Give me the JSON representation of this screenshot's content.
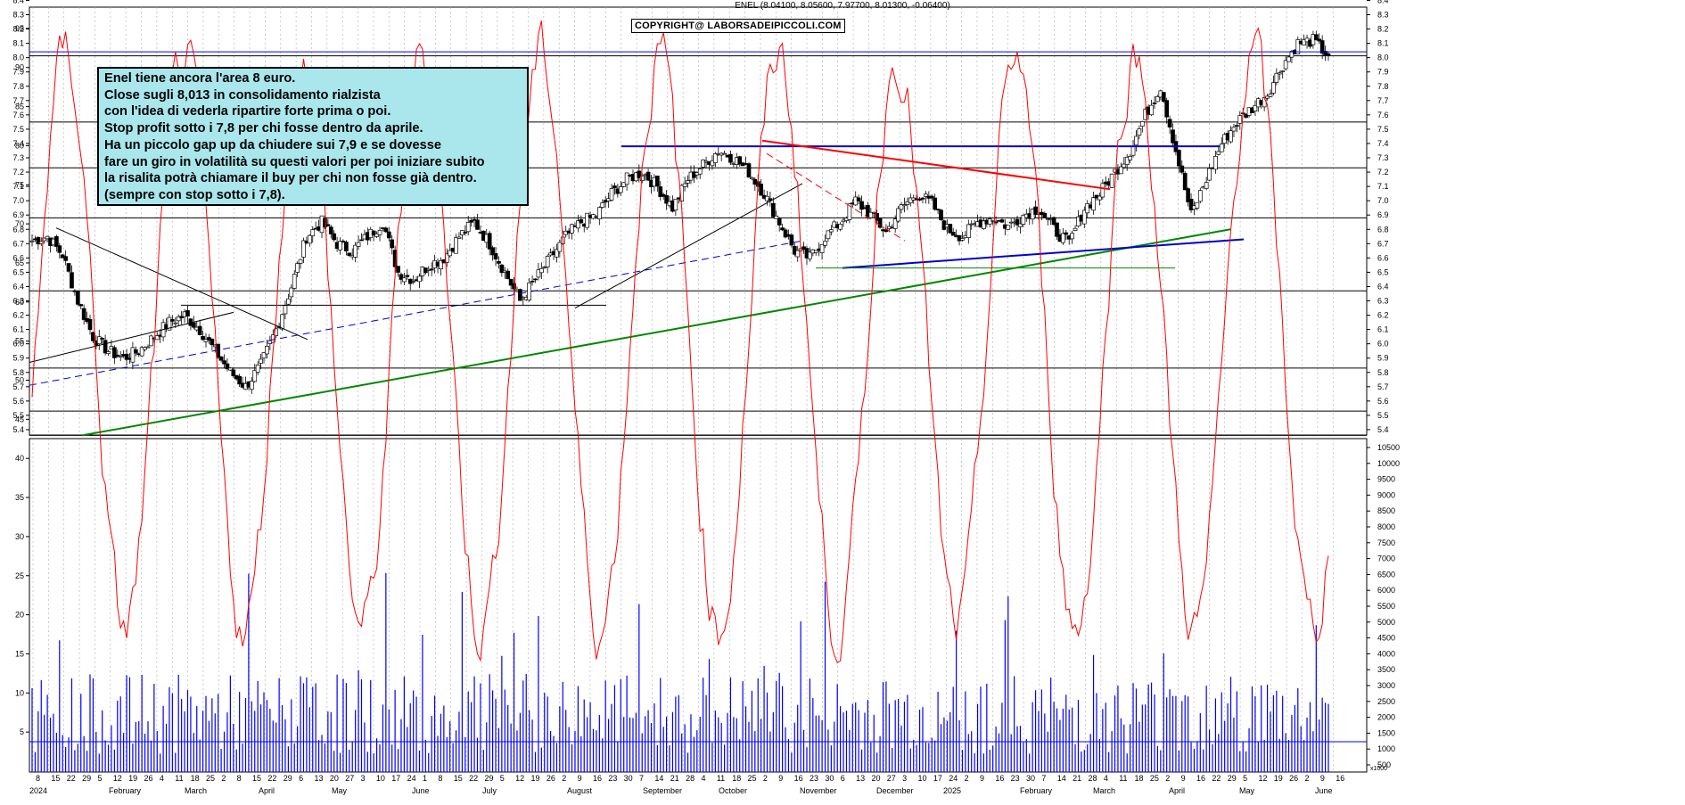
{
  "header": "ENEL (8.04100, 8.05600, 7.97700, 8.01300, -0.06400)",
  "copyright": "COPYRIGHT@ LABORSADEIPICCOLI.COM",
  "note_lines": [
    "Enel tiene ancora l'area 8 euro.",
    "Close sugli 8,013 in consolidamento rialzista",
    "con l'idea di vederla ripartire forte prima o poi.",
    "Stop profit sotto i 7,8 per chi fosse dentro da aprile.",
    "Ha un piccolo gap up da chiudere sui 7,9 e se dovesse",
    "fare un giro in volatilità su questi valori per poi iniziare subito",
    "la risalita potrà chiamare il buy per chi non fosse già dentro.",
    "(sempre con stop sotto i 7,8)."
  ],
  "colors": {
    "up": "#ffffff",
    "down": "#000000",
    "grid": "#aaaaaa",
    "oscillator": "#ff0000",
    "volume": "#0000ff",
    "trend_green": "#008800",
    "trend_red": "#ff0000",
    "trend_blue": "#0000cc"
  },
  "chart_data": [
    {
      "type": "candlestick",
      "title": "ENEL",
      "ohlc_last": {
        "open": 8.041,
        "high": 8.056,
        "low": 7.977,
        "close": 8.013,
        "change": -0.064
      },
      "ylim": [
        5.3,
        8.4
      ],
      "y_ticks": [
        "8.4",
        "8.3",
        "8.2",
        "8.1",
        "8.0",
        "7.9",
        "7.8",
        "7.7",
        "7.6",
        "7.5",
        "7.4",
        "7.3",
        "7.2",
        "7.1",
        "7.0",
        "6.9",
        "6.8",
        "6.7",
        "6.6",
        "6.5",
        "6.4",
        "6.3",
        "6.2",
        "6.1",
        "6.0",
        "5.9",
        "5.8",
        "5.7",
        "5.6",
        "5.5",
        "5.4"
      ],
      "horizontal_levels": [
        8.013,
        7.55,
        7.23,
        6.88,
        6.37,
        5.83,
        5.53,
        5.36
      ],
      "x_day_ticks": [
        "8",
        "15",
        "22",
        "29",
        "5",
        "12",
        "19",
        "26",
        "4",
        "11",
        "18",
        "25",
        "2",
        "8",
        "15",
        "22",
        "29",
        "6",
        "13",
        "20",
        "27",
        "3",
        "10",
        "17",
        "24",
        "1",
        "8",
        "15",
        "22",
        "29",
        "5",
        "12",
        "19",
        "26",
        "2",
        "9",
        "16",
        "23",
        "30",
        "7",
        "14",
        "21",
        "28",
        "4",
        "11",
        "18",
        "25",
        "2",
        "9",
        "16",
        "23",
        "30",
        "6",
        "13",
        "20",
        "27",
        "3",
        "10",
        "17",
        "24",
        "2",
        "9",
        "16",
        "23",
        "30",
        "7",
        "14",
        "21",
        "28",
        "4",
        "11",
        "18",
        "25",
        "2",
        "9",
        "16",
        "22",
        "29",
        "5",
        "12",
        "19",
        "26",
        "2",
        "9",
        "16"
      ],
      "x_month_labels": [
        "2024",
        "February",
        "March",
        "April",
        "May",
        "June",
        "July",
        "August",
        "September",
        "October",
        "November",
        "December",
        "2025",
        "February",
        "March",
        "April",
        "May",
        "June"
      ],
      "closes_weekly": [
        6.72,
        6.75,
        6.62,
        6.3,
        6.05,
        5.95,
        5.9,
        5.95,
        6.05,
        6.15,
        6.2,
        6.1,
        5.95,
        5.8,
        5.7,
        5.85,
        6.1,
        6.4,
        6.75,
        6.85,
        6.7,
        6.65,
        6.75,
        6.85,
        6.5,
        6.45,
        6.55,
        6.6,
        6.75,
        6.85,
        6.7,
        6.5,
        6.3,
        6.45,
        6.6,
        6.75,
        6.85,
        6.9,
        7.05,
        7.15,
        7.2,
        7.1,
        6.95,
        7.15,
        7.25,
        7.35,
        7.3,
        7.2,
        7.05,
        6.85,
        6.65,
        6.6,
        6.75,
        6.85,
        7.0,
        6.9,
        6.78,
        6.95,
        7.05,
        6.98,
        6.8,
        6.75,
        6.85,
        6.88,
        6.82,
        6.9,
        6.95,
        6.8,
        6.7,
        6.95,
        7.05,
        7.2,
        7.35,
        7.6,
        7.8,
        7.35,
        6.9,
        7.15,
        7.4,
        7.55,
        7.65,
        7.75,
        7.95,
        8.1,
        8.12,
        8.013
      ],
      "annotations": [
        "trendline green ascending from 5.36 (Jan 2024) to 6.8 (Apr 2025)",
        "red descending line Oct 2024 - Mar 2025",
        "blue horizontal 7.4 Oct 2024 - Mar 2025",
        "blue ascending support Nov 2024 - Apr 2025"
      ]
    },
    {
      "type": "line+bar",
      "oscillator_ylim": [
        0,
        105
      ],
      "oscillator_ticks": [
        "100",
        "95",
        "90",
        "85",
        "80",
        "75",
        "70",
        "65",
        "60",
        "55",
        "50",
        "45",
        "40",
        "35",
        "30",
        "25",
        "20",
        "15",
        "10",
        "5"
      ],
      "volume_ticks": [
        "10500",
        "10000",
        "9500",
        "9000",
        "8500",
        "8000",
        "7500",
        "7000",
        "6500",
        "6000",
        "5500",
        "5000",
        "4500",
        "4000",
        "3500",
        "3000",
        "2500",
        "2000",
        "1500",
        "1000",
        "500"
      ],
      "volume_unit": "x1000",
      "reference_levels": {
        "oscillator_upper": 92,
        "volume_baseline": 1600
      }
    }
  ]
}
